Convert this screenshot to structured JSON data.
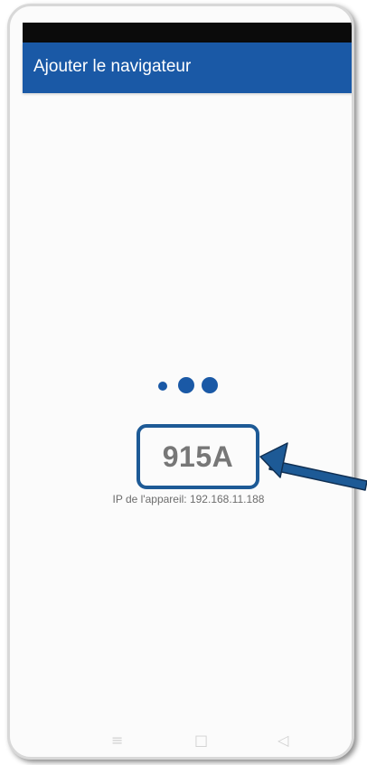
{
  "app_bar": {
    "title": "Ajouter le navigateur"
  },
  "loading_indicator": {
    "icon": "loading-dots-icon",
    "color": "#1a59a6"
  },
  "pairing": {
    "code": "915A",
    "device_ip_text": "IP de l'appareil: 192.168.11.188"
  },
  "nav_bar": {
    "recents_glyph": "≡",
    "home_glyph": "□",
    "back_glyph": "◁"
  },
  "annotation": {
    "icon": "arrow-icon",
    "color": "#1d5a96"
  }
}
